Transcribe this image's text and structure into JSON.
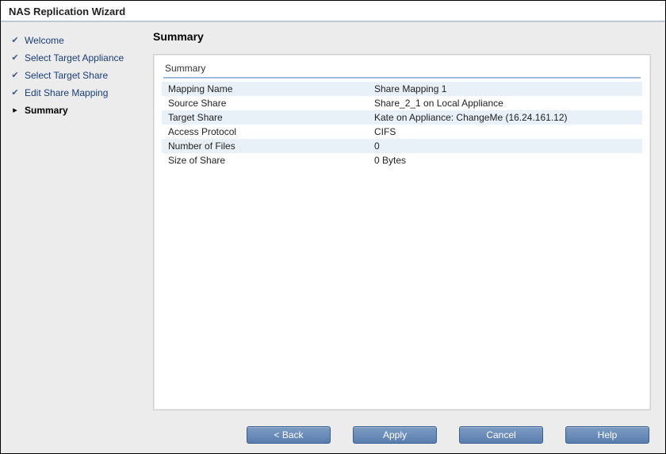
{
  "window": {
    "title": "NAS Replication Wizard"
  },
  "sidebar": {
    "steps": [
      {
        "label": "Welcome",
        "state": "done"
      },
      {
        "label": "Select Target Appliance",
        "state": "done"
      },
      {
        "label": "Select Target Share",
        "state": "done"
      },
      {
        "label": "Edit Share Mapping",
        "state": "done"
      },
      {
        "label": "Summary",
        "state": "current"
      }
    ]
  },
  "main": {
    "heading": "Summary",
    "panel_title": "Summary",
    "rows": [
      {
        "key": "Mapping Name",
        "value": "Share Mapping 1"
      },
      {
        "key": "Source Share",
        "value": "Share_2_1 on Local Appliance"
      },
      {
        "key": "Target Share",
        "value": "Kate on Appliance: ChangeMe (16.24.161.12)"
      },
      {
        "key": "Access Protocol",
        "value": "CIFS"
      },
      {
        "key": "Number of Files",
        "value": "0"
      },
      {
        "key": "Size of Share",
        "value": "0 Bytes"
      }
    ]
  },
  "footer": {
    "back": "< Back",
    "apply": "Apply",
    "cancel": "Cancel",
    "help": "Help"
  }
}
